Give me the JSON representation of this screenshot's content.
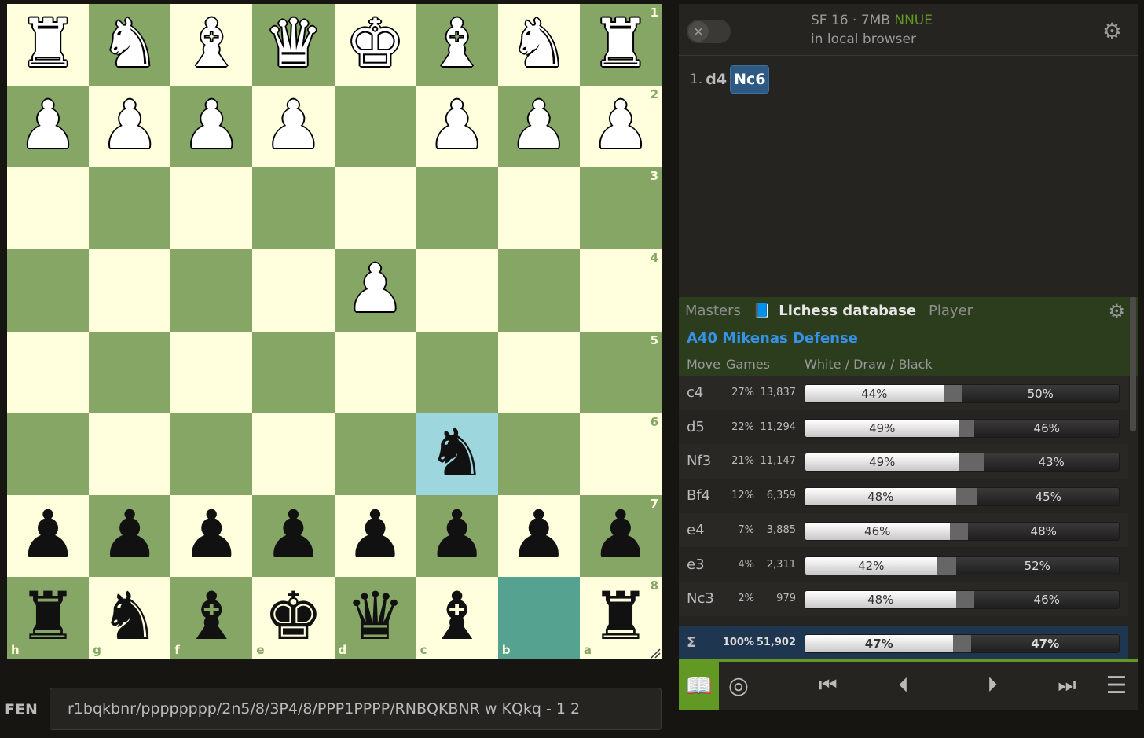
{
  "board": {
    "ranks": [
      [
        "♜",
        "♞",
        "♝",
        "♛",
        "♚",
        "♝",
        "♞",
        "♜"
      ],
      [
        "♟",
        "♟",
        "♟",
        "♟",
        "",
        "♟",
        "♟",
        "♟"
      ],
      [
        "",
        "",
        "",
        "",
        "",
        "",
        "",
        ""
      ],
      [
        "",
        "",
        "",
        "",
        "♟",
        "",
        "",
        ""
      ],
      [
        "",
        "",
        "",
        "",
        "",
        "",
        "",
        ""
      ],
      [
        "",
        "",
        "",
        "",
        "",
        "♞",
        "",
        ""
      ],
      [
        "♟",
        "♟",
        "♟",
        "♟",
        "♟",
        "♟",
        "♟",
        "♟"
      ],
      [
        "♜",
        "♞",
        "♝",
        "♚",
        "♛",
        "♝",
        "",
        "♜"
      ]
    ],
    "colors": [
      [
        "w",
        "w",
        "w",
        "w",
        "w",
        "w",
        "w",
        "w"
      ],
      [
        "w",
        "w",
        "w",
        "w",
        "",
        "w",
        "w",
        "w"
      ],
      [
        "",
        "",
        "",
        "",
        "",
        "",
        "",
        ""
      ],
      [
        "",
        "",
        "",
        "",
        "w",
        "",
        "",
        ""
      ],
      [
        "",
        "",
        "",
        "",
        "",
        "",
        "",
        ""
      ],
      [
        "",
        "",
        "",
        "",
        "",
        "b",
        "",
        ""
      ],
      [
        "b",
        "b",
        "b",
        "b",
        "b",
        "b",
        "b",
        "b"
      ],
      [
        "b",
        "b",
        "b",
        "b",
        "b",
        "b",
        "",
        "b"
      ]
    ],
    "rank_labels": [
      "1",
      "2",
      "3",
      "4",
      "5",
      "6",
      "7",
      "8"
    ],
    "file_labels": [
      "h",
      "g",
      "f",
      "e",
      "d",
      "c",
      "b",
      "a"
    ],
    "highlight_squares": [
      "5-5"
    ],
    "lastmove_squares": [
      "7-6"
    ],
    "light_color": "#ffffdd",
    "dark_color": "#86a666"
  },
  "fen": {
    "label": "FEN",
    "value": "r1bqkbnr/pppppppp/2n5/8/3P4/8/PPP1PPPP/RNBQKBNR w KQkq - 1 2"
  },
  "ceval": {
    "toggle_icon": "✕",
    "engine": "SF 16 · 7MB",
    "nnue": "NNUE",
    "subtitle": "in local browser",
    "gear_icon": "⚙"
  },
  "moves": {
    "number": "1.",
    "white": "d4",
    "black": "Nc6"
  },
  "explorer": {
    "tabs": [
      "Masters",
      "Lichess database",
      "Player"
    ],
    "book_icon": "📘",
    "gear_icon": "⚙",
    "opening": "A40 Mikenas Defense",
    "headers": {
      "move": "Move",
      "games": "Games",
      "results": "White / Draw / Black"
    },
    "rows": [
      {
        "move": "c4",
        "pct": "27%",
        "games": "13,837",
        "white": 44,
        "draw": 6,
        "black": 50,
        "white_label": "44%",
        "black_label": "50%"
      },
      {
        "move": "d5",
        "pct": "22%",
        "games": "11,294",
        "white": 49,
        "draw": 5,
        "black": 46,
        "white_label": "49%",
        "black_label": "46%"
      },
      {
        "move": "Nf3",
        "pct": "21%",
        "games": "11,147",
        "white": 49,
        "draw": 8,
        "black": 43,
        "white_label": "49%",
        "black_label": "43%"
      },
      {
        "move": "Bf4",
        "pct": "12%",
        "games": "6,359",
        "white": 48,
        "draw": 7,
        "black": 45,
        "white_label": "48%",
        "black_label": "45%"
      },
      {
        "move": "e4",
        "pct": "7%",
        "games": "3,885",
        "white": 46,
        "draw": 6,
        "black": 48,
        "white_label": "46%",
        "black_label": "48%"
      },
      {
        "move": "e3",
        "pct": "4%",
        "games": "2,311",
        "white": 42,
        "draw": 6,
        "black": 52,
        "white_label": "42%",
        "black_label": "52%"
      },
      {
        "move": "Nc3",
        "pct": "2%",
        "games": "979",
        "white": 48,
        "draw": 6,
        "black": 46,
        "white_label": "48%",
        "black_label": "46%"
      }
    ],
    "total": {
      "move": "Σ",
      "pct": "100%",
      "games": "51,902",
      "white": 47,
      "draw": 6,
      "black": 47,
      "white_label": "47%",
      "black_label": "47%"
    }
  },
  "controls": {
    "explorer_icon": "📖",
    "practice_icon": "◎",
    "first_icon": "⏮",
    "prev_icon": "⏴",
    "next_icon": "⏵",
    "last_icon": "⏭",
    "menu_icon": "☰"
  }
}
